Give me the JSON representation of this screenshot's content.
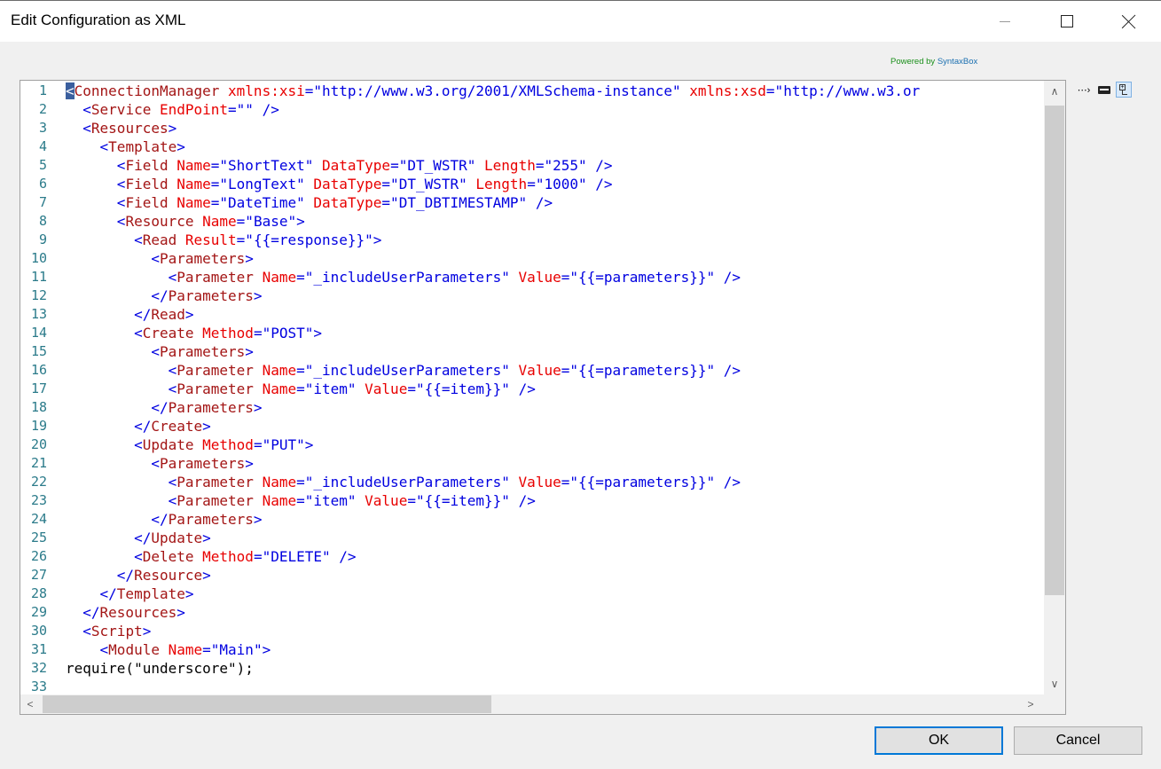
{
  "window": {
    "title": "Edit Configuration as XML",
    "controls": [
      "minimize-icon",
      "maximize-icon",
      "close-icon"
    ]
  },
  "powered_by": {
    "prefix": "Powered by ",
    "brand": "SyntaxBox"
  },
  "editor": {
    "lines": [
      {
        "n": "1",
        "indent": "",
        "segs": [
          [
            "caret",
            "<"
          ],
          [
            "t",
            "ConnectionManager "
          ],
          [
            "a",
            "xmlns:xsi"
          ],
          [
            "p",
            "=\""
          ],
          [
            "v",
            "http://www.w3.org/2001/XMLSchema-instance"
          ],
          [
            "p",
            "\" "
          ],
          [
            "a",
            "xmlns:xsd"
          ],
          [
            "p",
            "=\""
          ],
          [
            "v",
            "http://www.w3.or"
          ]
        ]
      },
      {
        "n": "2",
        "indent": "  ",
        "segs": [
          [
            "p",
            "<"
          ],
          [
            "t",
            "Service "
          ],
          [
            "a",
            "EndPoint"
          ],
          [
            "p",
            "=\"\" />"
          ]
        ]
      },
      {
        "n": "3",
        "indent": "  ",
        "segs": [
          [
            "p",
            "<"
          ],
          [
            "t",
            "Resources"
          ],
          [
            "p",
            ">"
          ]
        ]
      },
      {
        "n": "4",
        "indent": "    ",
        "segs": [
          [
            "p",
            "<"
          ],
          [
            "t",
            "Template"
          ],
          [
            "p",
            ">"
          ]
        ]
      },
      {
        "n": "5",
        "indent": "      ",
        "segs": [
          [
            "p",
            "<"
          ],
          [
            "t",
            "Field "
          ],
          [
            "a",
            "Name"
          ],
          [
            "p",
            "=\""
          ],
          [
            "v",
            "ShortText"
          ],
          [
            "p",
            "\" "
          ],
          [
            "a",
            "DataType"
          ],
          [
            "p",
            "=\""
          ],
          [
            "v",
            "DT_WSTR"
          ],
          [
            "p",
            "\" "
          ],
          [
            "a",
            "Length"
          ],
          [
            "p",
            "=\""
          ],
          [
            "v",
            "255"
          ],
          [
            "p",
            "\" />"
          ]
        ]
      },
      {
        "n": "6",
        "indent": "      ",
        "segs": [
          [
            "p",
            "<"
          ],
          [
            "t",
            "Field "
          ],
          [
            "a",
            "Name"
          ],
          [
            "p",
            "=\""
          ],
          [
            "v",
            "LongText"
          ],
          [
            "p",
            "\" "
          ],
          [
            "a",
            "DataType"
          ],
          [
            "p",
            "=\""
          ],
          [
            "v",
            "DT_WSTR"
          ],
          [
            "p",
            "\" "
          ],
          [
            "a",
            "Length"
          ],
          [
            "p",
            "=\""
          ],
          [
            "v",
            "1000"
          ],
          [
            "p",
            "\" />"
          ]
        ]
      },
      {
        "n": "7",
        "indent": "      ",
        "segs": [
          [
            "p",
            "<"
          ],
          [
            "t",
            "Field "
          ],
          [
            "a",
            "Name"
          ],
          [
            "p",
            "=\""
          ],
          [
            "v",
            "DateTime"
          ],
          [
            "p",
            "\" "
          ],
          [
            "a",
            "DataType"
          ],
          [
            "p",
            "=\""
          ],
          [
            "v",
            "DT_DBTIMESTAMP"
          ],
          [
            "p",
            "\" />"
          ]
        ]
      },
      {
        "n": "8",
        "indent": "      ",
        "segs": [
          [
            "p",
            "<"
          ],
          [
            "t",
            "Resource "
          ],
          [
            "a",
            "Name"
          ],
          [
            "p",
            "=\""
          ],
          [
            "v",
            "Base"
          ],
          [
            "p",
            "\">"
          ]
        ]
      },
      {
        "n": "9",
        "indent": "        ",
        "segs": [
          [
            "p",
            "<"
          ],
          [
            "t",
            "Read "
          ],
          [
            "a",
            "Result"
          ],
          [
            "p",
            "=\""
          ],
          [
            "v",
            "{{=response}}"
          ],
          [
            "p",
            "\">"
          ]
        ]
      },
      {
        "n": "10",
        "indent": "          ",
        "segs": [
          [
            "p",
            "<"
          ],
          [
            "t",
            "Parameters"
          ],
          [
            "p",
            ">"
          ]
        ]
      },
      {
        "n": "11",
        "indent": "            ",
        "segs": [
          [
            "p",
            "<"
          ],
          [
            "t",
            "Parameter "
          ],
          [
            "a",
            "Name"
          ],
          [
            "p",
            "=\""
          ],
          [
            "v",
            "_includeUserParameters"
          ],
          [
            "p",
            "\" "
          ],
          [
            "a",
            "Value"
          ],
          [
            "p",
            "=\""
          ],
          [
            "v",
            "{{=parameters}}"
          ],
          [
            "p",
            "\" />"
          ]
        ]
      },
      {
        "n": "12",
        "indent": "          ",
        "segs": [
          [
            "p",
            "</"
          ],
          [
            "t",
            "Parameters"
          ],
          [
            "p",
            ">"
          ]
        ]
      },
      {
        "n": "13",
        "indent": "        ",
        "segs": [
          [
            "p",
            "</"
          ],
          [
            "t",
            "Read"
          ],
          [
            "p",
            ">"
          ]
        ]
      },
      {
        "n": "14",
        "indent": "        ",
        "segs": [
          [
            "p",
            "<"
          ],
          [
            "t",
            "Create "
          ],
          [
            "a",
            "Method"
          ],
          [
            "p",
            "=\""
          ],
          [
            "v",
            "POST"
          ],
          [
            "p",
            "\">"
          ]
        ]
      },
      {
        "n": "15",
        "indent": "          ",
        "segs": [
          [
            "p",
            "<"
          ],
          [
            "t",
            "Parameters"
          ],
          [
            "p",
            ">"
          ]
        ]
      },
      {
        "n": "16",
        "indent": "            ",
        "segs": [
          [
            "p",
            "<"
          ],
          [
            "t",
            "Parameter "
          ],
          [
            "a",
            "Name"
          ],
          [
            "p",
            "=\""
          ],
          [
            "v",
            "_includeUserParameters"
          ],
          [
            "p",
            "\" "
          ],
          [
            "a",
            "Value"
          ],
          [
            "p",
            "=\""
          ],
          [
            "v",
            "{{=parameters}}"
          ],
          [
            "p",
            "\" />"
          ]
        ]
      },
      {
        "n": "17",
        "indent": "            ",
        "segs": [
          [
            "p",
            "<"
          ],
          [
            "t",
            "Parameter "
          ],
          [
            "a",
            "Name"
          ],
          [
            "p",
            "=\""
          ],
          [
            "v",
            "item"
          ],
          [
            "p",
            "\" "
          ],
          [
            "a",
            "Value"
          ],
          [
            "p",
            "=\""
          ],
          [
            "v",
            "{{=item}}"
          ],
          [
            "p",
            "\" />"
          ]
        ]
      },
      {
        "n": "18",
        "indent": "          ",
        "segs": [
          [
            "p",
            "</"
          ],
          [
            "t",
            "Parameters"
          ],
          [
            "p",
            ">"
          ]
        ]
      },
      {
        "n": "19",
        "indent": "        ",
        "segs": [
          [
            "p",
            "</"
          ],
          [
            "t",
            "Create"
          ],
          [
            "p",
            ">"
          ]
        ]
      },
      {
        "n": "20",
        "indent": "        ",
        "segs": [
          [
            "p",
            "<"
          ],
          [
            "t",
            "Update "
          ],
          [
            "a",
            "Method"
          ],
          [
            "p",
            "=\""
          ],
          [
            "v",
            "PUT"
          ],
          [
            "p",
            "\">"
          ]
        ]
      },
      {
        "n": "21",
        "indent": "          ",
        "segs": [
          [
            "p",
            "<"
          ],
          [
            "t",
            "Parameters"
          ],
          [
            "p",
            ">"
          ]
        ]
      },
      {
        "n": "22",
        "indent": "            ",
        "segs": [
          [
            "p",
            "<"
          ],
          [
            "t",
            "Parameter "
          ],
          [
            "a",
            "Name"
          ],
          [
            "p",
            "=\""
          ],
          [
            "v",
            "_includeUserParameters"
          ],
          [
            "p",
            "\" "
          ],
          [
            "a",
            "Value"
          ],
          [
            "p",
            "=\""
          ],
          [
            "v",
            "{{=parameters}}"
          ],
          [
            "p",
            "\" />"
          ]
        ]
      },
      {
        "n": "23",
        "indent": "            ",
        "segs": [
          [
            "p",
            "<"
          ],
          [
            "t",
            "Parameter "
          ],
          [
            "a",
            "Name"
          ],
          [
            "p",
            "=\""
          ],
          [
            "v",
            "item"
          ],
          [
            "p",
            "\" "
          ],
          [
            "a",
            "Value"
          ],
          [
            "p",
            "=\""
          ],
          [
            "v",
            "{{=item}}"
          ],
          [
            "p",
            "\" />"
          ]
        ]
      },
      {
        "n": "24",
        "indent": "          ",
        "segs": [
          [
            "p",
            "</"
          ],
          [
            "t",
            "Parameters"
          ],
          [
            "p",
            ">"
          ]
        ]
      },
      {
        "n": "25",
        "indent": "        ",
        "segs": [
          [
            "p",
            "</"
          ],
          [
            "t",
            "Update"
          ],
          [
            "p",
            ">"
          ]
        ]
      },
      {
        "n": "26",
        "indent": "        ",
        "segs": [
          [
            "p",
            "<"
          ],
          [
            "t",
            "Delete "
          ],
          [
            "a",
            "Method"
          ],
          [
            "p",
            "=\""
          ],
          [
            "v",
            "DELETE"
          ],
          [
            "p",
            "\" />"
          ]
        ]
      },
      {
        "n": "27",
        "indent": "      ",
        "segs": [
          [
            "p",
            "</"
          ],
          [
            "t",
            "Resource"
          ],
          [
            "p",
            ">"
          ]
        ]
      },
      {
        "n": "28",
        "indent": "    ",
        "segs": [
          [
            "p",
            "</"
          ],
          [
            "t",
            "Template"
          ],
          [
            "p",
            ">"
          ]
        ]
      },
      {
        "n": "29",
        "indent": "  ",
        "segs": [
          [
            "p",
            "</"
          ],
          [
            "t",
            "Resources"
          ],
          [
            "p",
            ">"
          ]
        ]
      },
      {
        "n": "30",
        "indent": "  ",
        "segs": [
          [
            "p",
            "<"
          ],
          [
            "t",
            "Script"
          ],
          [
            "p",
            ">"
          ]
        ]
      },
      {
        "n": "31",
        "indent": "    ",
        "segs": [
          [
            "p",
            "<"
          ],
          [
            "t",
            "Module "
          ],
          [
            "a",
            "Name"
          ],
          [
            "p",
            "=\""
          ],
          [
            "v",
            "Main"
          ],
          [
            "p",
            "\">"
          ]
        ]
      },
      {
        "n": "32",
        "indent": "",
        "segs": [
          [
            "plain",
            "require(\"underscore\");"
          ]
        ]
      },
      {
        "n": "33",
        "indent": "",
        "segs": []
      }
    ]
  },
  "toolbar_side": [
    "arrow-icon",
    "keyboard-icon",
    "tree-icon"
  ],
  "buttons": {
    "ok": "OK",
    "cancel": "Cancel"
  }
}
